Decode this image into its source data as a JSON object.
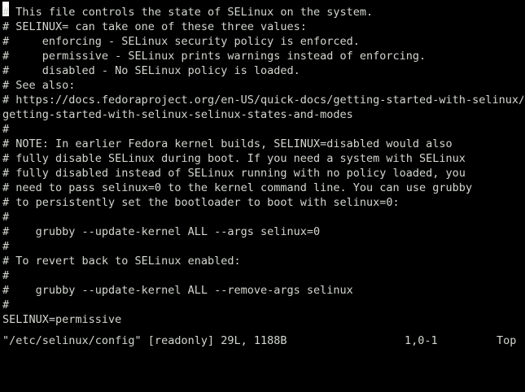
{
  "editor": {
    "lines": [
      "# This file controls the state of SELinux on the system.",
      "# SELINUX= can take one of these three values:",
      "#     enforcing - SELinux security policy is enforced.",
      "#     permissive - SELinux prints warnings instead of enforcing.",
      "#     disabled - No SELinux policy is loaded.",
      "# See also:",
      "# https://docs.fedoraproject.org/en-US/quick-docs/getting-started-with-selinux/#",
      "getting-started-with-selinux-selinux-states-and-modes",
      "#",
      "# NOTE: In earlier Fedora kernel builds, SELINUX=disabled would also",
      "# fully disable SELinux during boot. If you need a system with SELinux",
      "# fully disabled instead of SELinux running with no policy loaded, you",
      "# need to pass selinux=0 to the kernel command line. You can use grubby",
      "# to persistently set the bootloader to boot with selinux=0:",
      "#",
      "#    grubby --update-kernel ALL --args selinux=0",
      "#",
      "# To revert back to SELinux enabled:",
      "#",
      "#    grubby --update-kernel ALL --remove-args selinux",
      "#",
      "SELINUX=permissive"
    ]
  },
  "status": {
    "file": "\"/etc/selinux/config\" [readonly] 29L, 1188B",
    "position": "1,0-1",
    "scroll": "Top"
  },
  "colors": {
    "background": "#000000",
    "foreground": "#d3d7cf",
    "cursor": "#ffffff"
  }
}
